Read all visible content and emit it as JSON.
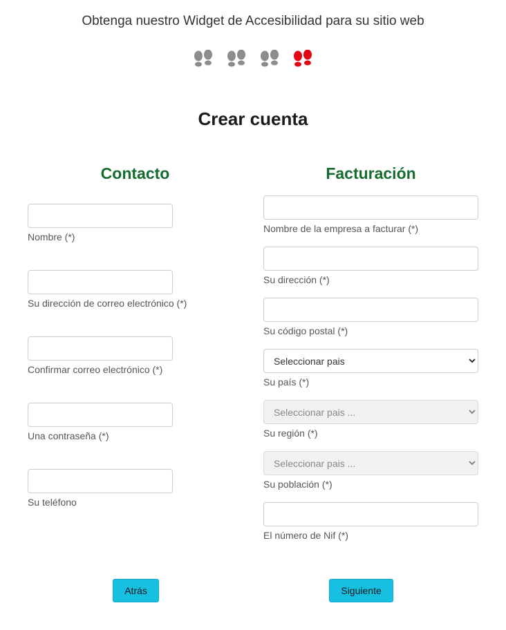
{
  "header": {
    "title": "Obtenga nuestro Widget de Accesibilidad para su sitio web"
  },
  "steps": {
    "completed_color": "#8c8c8c",
    "current_color": "#e30613"
  },
  "form": {
    "heading": "Crear cuenta"
  },
  "contact": {
    "heading": "Contacto",
    "name_label": "Nombre (*)",
    "email_label": "Su dirección de correo electrónico (*)",
    "email_confirm_label": "Confirmar correo electrónico (*)",
    "password_label": "Una contraseña (*)",
    "phone_label": "Su teléfono"
  },
  "billing": {
    "heading": "Facturación",
    "company_label": "Nombre de la empresa a facturar (*)",
    "address_label": "Su dirección (*)",
    "postal_label": "Su código postal (*)",
    "country_placeholder": "Seleccionar pais",
    "country_label": "Su país (*)",
    "region_placeholder": "Seleccionar pais ...",
    "region_label": "Su región (*)",
    "city_placeholder": "Seleccionar pais ...",
    "city_label": "Su población (*)",
    "nif_label": "El número de Nif (*)"
  },
  "nav": {
    "back": "Atrás",
    "next": "Siguiente"
  }
}
